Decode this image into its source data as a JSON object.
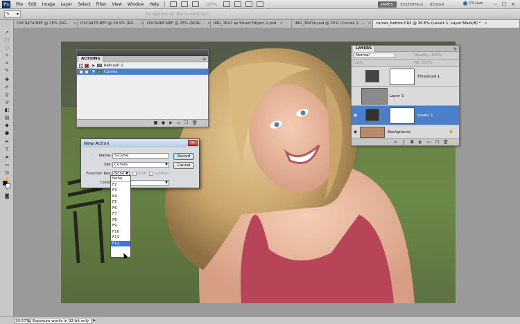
{
  "menubar": {
    "app_logo": "Ps",
    "items": [
      "File",
      "Edit",
      "Image",
      "Layer",
      "Select",
      "Filter",
      "View",
      "Window",
      "Help"
    ],
    "zoom": "100%",
    "workspaces": [
      "JAMES",
      "ESSENTIALS",
      "DESIGN"
    ],
    "cs_live": "CS Live"
  },
  "options_bar": {
    "message": "No options for the current tool"
  },
  "tabs": [
    {
      "label": "DSC9474.NEF @ 25% (RG..."
    },
    {
      "label": "DSC9475.NEF @ 29.9% (RG..."
    },
    {
      "label": "DSC9466.NEF @ 25% (RGB/..."
    },
    {
      "label": "IMG_3647 as Smart Object-1.psd"
    },
    {
      "label": "IMG_3647b.psd @ 25% (Curves 1, ..."
    },
    {
      "label": "curves_before.CR2 @ 30.6% (Levels 1, Layer Mask/8) *",
      "active": true
    }
  ],
  "actions_panel": {
    "tab": "ACTIONS",
    "rows": [
      {
        "label": "Retouch 1",
        "type": "set"
      },
      {
        "label": "Curves",
        "type": "action",
        "selected": true
      }
    ]
  },
  "layers_panel": {
    "tab": "LAYERS",
    "blend_mode": "Normal",
    "opacity_label": "Opacity:",
    "opacity_value": "100%",
    "lock_label": "Lock:",
    "fill_label": "Fill:",
    "fill_value": "100%",
    "layers": [
      {
        "name": "Threshold 1"
      },
      {
        "name": "Layer 1"
      },
      {
        "name": "Levels 1",
        "selected": true
      },
      {
        "name": "Background"
      }
    ]
  },
  "new_action_dialog": {
    "title": "New Action",
    "name_label": "Name:",
    "name_value": "S-Curve",
    "set_label": "Set:",
    "set_value": "Curves",
    "function_key_label": "Function Key:",
    "function_key_value": "None",
    "shift_label": "Shift",
    "control_label": "Control",
    "color_label": "Color:",
    "record_label": "Record",
    "cancel_label": "Cancel"
  },
  "function_key_options": [
    "None",
    "F2",
    "F3",
    "F4",
    "F5",
    "F6",
    "F7",
    "F8",
    "F9",
    "F10",
    "F11",
    "F12"
  ],
  "function_key_highlighted": "F12",
  "status": {
    "zoom": "30.57%",
    "message": "Exposure works in 32-bit only"
  },
  "colors": {
    "selection": "#4b7fc9",
    "record_red": "#c41d1d",
    "panel_bg": "#d6d6d6"
  }
}
